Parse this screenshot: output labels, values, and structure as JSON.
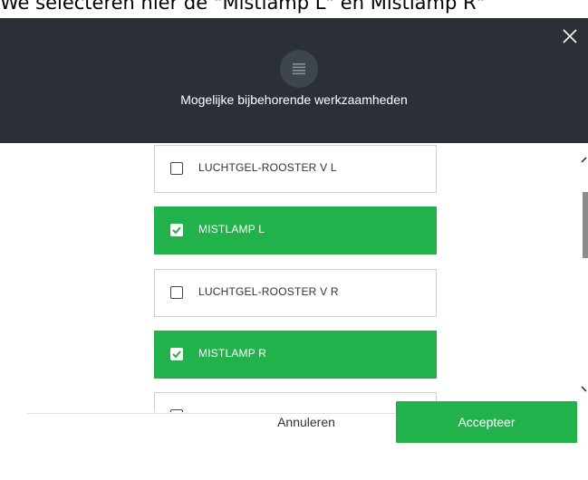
{
  "caption": "We selecteren hier de \"Mistlamp L\" en Mistlamp R\"",
  "dialog": {
    "header_icon": "list-icon",
    "title": "Mogelijke bijbehorende werkzaamheden",
    "close_icon": "close-icon"
  },
  "items": [
    {
      "label": "LUCHTGEL-ROOSTER V L",
      "checked": false
    },
    {
      "label": "MISTLAMP L",
      "checked": true
    },
    {
      "label": "LUCHTGEL-ROOSTER V R",
      "checked": false
    },
    {
      "label": "MISTLAMP R",
      "checked": true
    },
    {
      "label": "",
      "checked": false
    }
  ],
  "buttons": {
    "cancel_label": "Annuleren",
    "accept_label": "Accepteer"
  },
  "colors": {
    "header_bg": "#2b3036",
    "selected_bg": "#21b24b",
    "accept_bg": "#21b24b"
  }
}
